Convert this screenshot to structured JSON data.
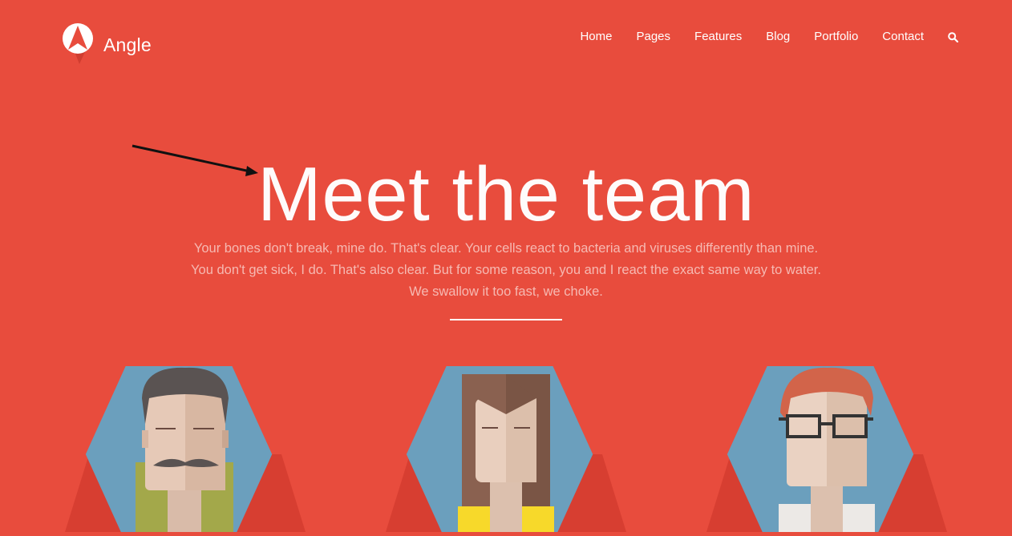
{
  "header": {
    "brand": "Angle",
    "nav": [
      "Home",
      "Pages",
      "Features",
      "Blog",
      "Portfolio",
      "Contact"
    ],
    "search_icon": "search-icon"
  },
  "hero": {
    "title": "Meet the team",
    "subtitle": "Your bones don't break, mine do. That's clear. Your cells react to bacteria and viruses differently than mine. You don't get sick, I do. That's also clear. But for some reason, you and I react the exact same way to water. We swallow it too fast, we choke."
  },
  "annotation": {
    "icon": "arrow-icon"
  },
  "team": [
    {
      "avatar": "man-mustache-avatar"
    },
    {
      "avatar": "woman-long-hair-avatar"
    },
    {
      "avatar": "man-glasses-avatar"
    }
  ],
  "colors": {
    "background": "#e84c3d",
    "hexagon": "#6b9fbd",
    "text": "#ffffff"
  }
}
